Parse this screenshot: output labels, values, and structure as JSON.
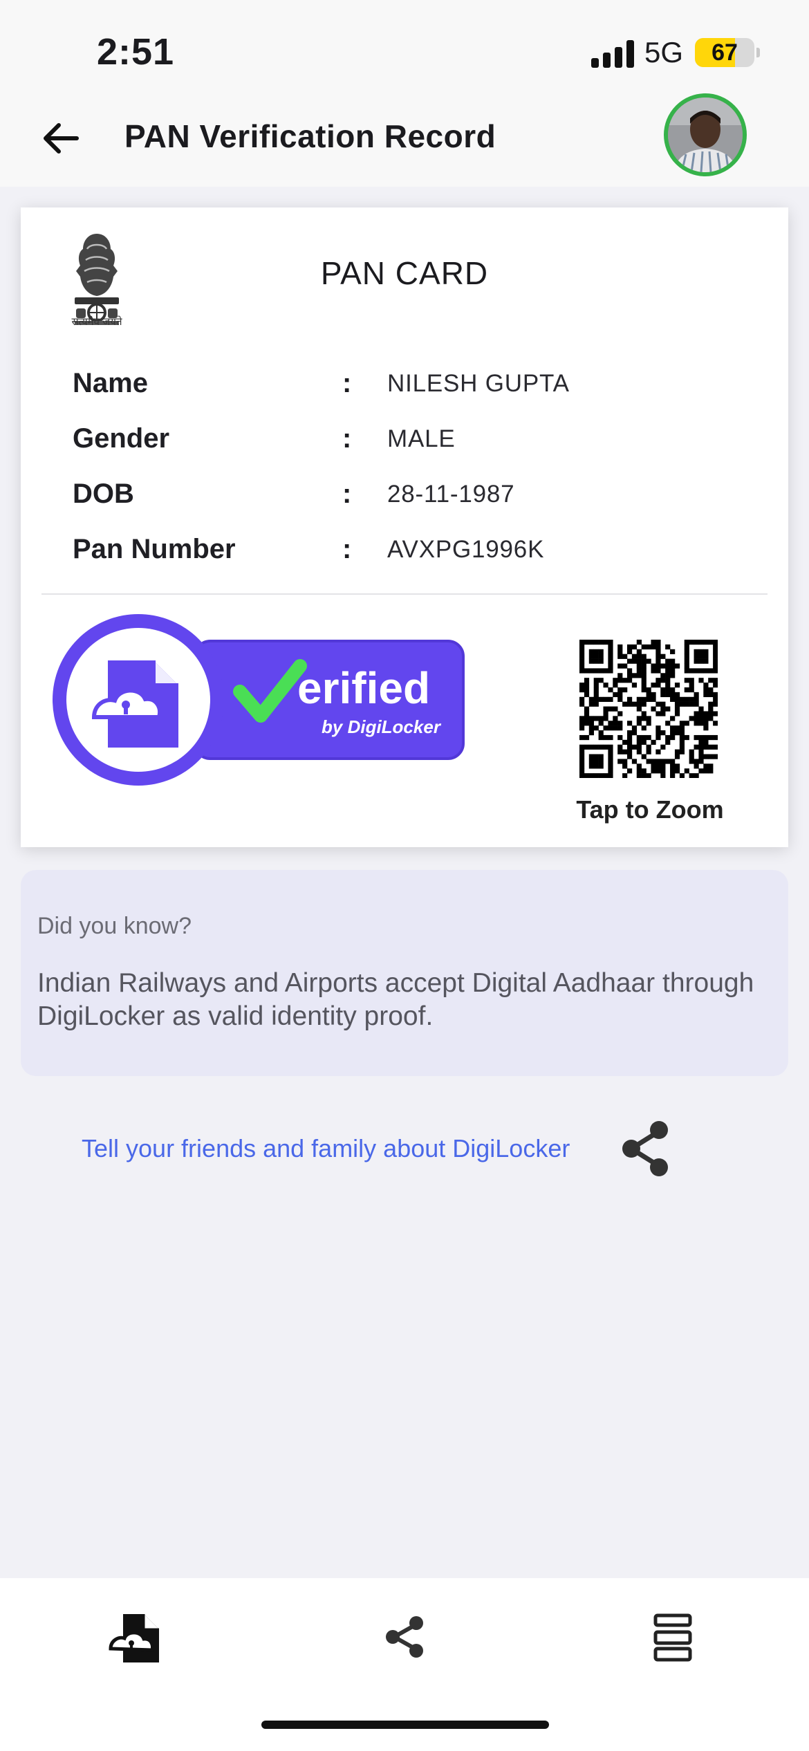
{
  "status_bar": {
    "time": "2:51",
    "network": "5G",
    "battery": "67",
    "battery_level": 0.67
  },
  "header": {
    "title": "PAN Verification Record",
    "back_icon": "arrow-left-icon",
    "avatar_icon": "user-photo"
  },
  "card": {
    "title": "PAN CARD",
    "emblem_motto": "सत्यमेव जयते",
    "fields": [
      {
        "label": "Name",
        "separator": ":",
        "value": "NILESH GUPTA"
      },
      {
        "label": "Gender",
        "separator": ":",
        "value": "MALE"
      },
      {
        "label": "DOB",
        "separator": ":",
        "value": "28-11-1987"
      },
      {
        "label": "Pan Number",
        "separator": ":",
        "value": "AVXPG1996K"
      }
    ],
    "badge": {
      "main": "erified",
      "sub": "by DigiLocker",
      "color": "#6246ee",
      "check_color": "#4ade55"
    },
    "qr_caption": "Tap to Zoom"
  },
  "info_box": {
    "heading": "Did you know?",
    "body": "Indian Railways and Airports accept Digital Aadhaar through DigiLocker as valid identity proof."
  },
  "share": {
    "text": "Tell your friends and family about DigiLocker",
    "icon": "share-icon"
  },
  "bottom_bar": {
    "tabs": [
      {
        "icon": "document-lock-icon"
      },
      {
        "icon": "share-icon"
      },
      {
        "icon": "list-icon"
      }
    ]
  },
  "colors": {
    "accent": "#4a68e8",
    "badge": "#6246ee",
    "avatar_ring": "#36b24a",
    "info_bg": "#e8e8f6"
  }
}
